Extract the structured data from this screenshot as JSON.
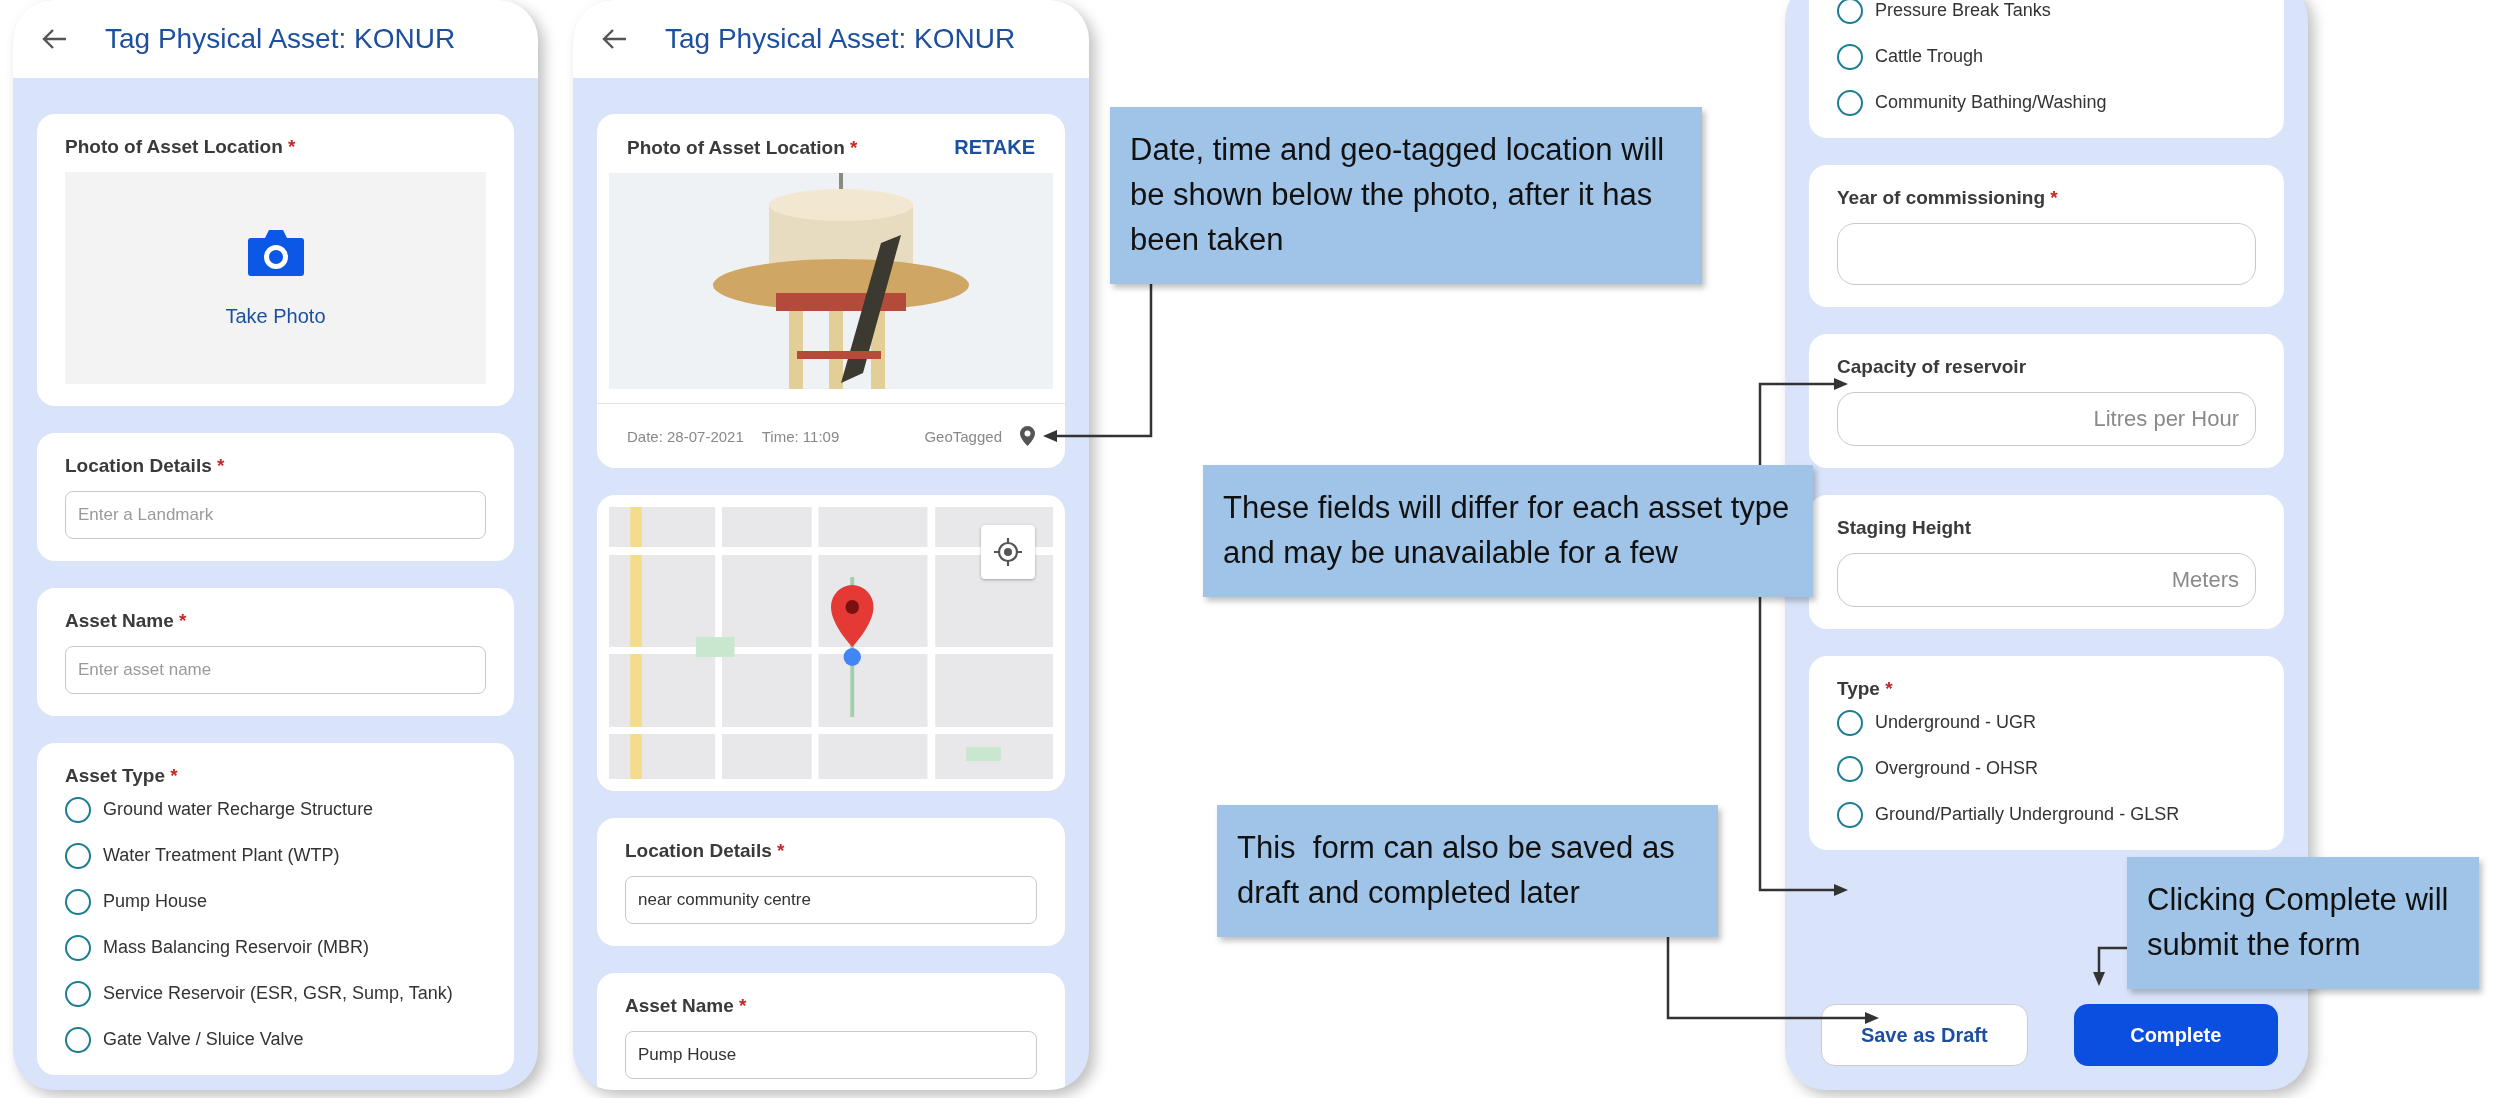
{
  "screens": [
    {
      "title": "Tag Physical Asset: KONUR",
      "sections": [
        {
          "label": "Photo of Asset Location",
          "mark": "*",
          "action": "Take Photo"
        },
        {
          "kind": "input",
          "label": "Location Details",
          "mark": "*",
          "placeholder": "Enter a Landmark"
        },
        {
          "kind": "input",
          "label": "Asset Name",
          "mark": "*",
          "placeholder": "Enter asset name"
        },
        {
          "kind": "radios",
          "label": "Asset Type",
          "mark": "*",
          "options": [
            {
              "label": "Ground water Recharge Structure",
              "selected": false
            },
            {
              "label": "Water Treatment Plant (WTP)",
              "selected": false
            },
            {
              "label": "Pump House",
              "selected": false
            },
            {
              "label": "Mass Balancing Reservoir (MBR)",
              "selected": false
            },
            {
              "label": "Service Reservoir (ESR, GSR, Sump, Tank)",
              "selected": false
            },
            {
              "label": "Gate Valve / Sluice Valve",
              "selected": false
            }
          ]
        }
      ]
    },
    {
      "title": "Tag Physical Asset: KONUR",
      "sections": [
        {
          "kind": "photo_taken",
          "label": "Photo of Asset Location",
          "mark": "*",
          "action": "RETAKE",
          "date": "Date: 28-07-2021",
          "time": "Time: 11:09",
          "geo": "GeoTagged"
        },
        {
          "kind": "map"
        },
        {
          "kind": "input",
          "label": "Location Details",
          "mark": "*",
          "value": "near community centre"
        },
        {
          "kind": "input",
          "label": "Asset Name",
          "mark": "*",
          "value": "Pump House"
        }
      ]
    },
    {
      "sections": [
        {
          "kind": "radios",
          "options": [
            {
              "label": "Pressure Break Tanks",
              "selected": false
            },
            {
              "label": "Cattle Trough",
              "selected": false
            },
            {
              "label": "Community Bathing/Washing",
              "selected": false
            }
          ]
        },
        {
          "kind": "input",
          "label": "Year of commissioning",
          "mark": "*"
        },
        {
          "kind": "unit_input",
          "label": "Capacity of reservoir",
          "placeholder": "Litres per Hour"
        },
        {
          "kind": "unit_input",
          "label": "Staging Height",
          "placeholder": "Meters"
        },
        {
          "kind": "radios",
          "label": "Type",
          "mark": "*",
          "options": [
            {
              "label": "Underground - UGR",
              "selected": false
            },
            {
              "label": "Overground - OHSR",
              "selected": false
            },
            {
              "label": "Ground/Partially Underground - GLSR",
              "selected": false
            }
          ]
        }
      ],
      "actions": [
        {
          "label": "Save as Draft",
          "primary": false
        },
        {
          "label": "Complete",
          "primary": true
        }
      ]
    }
  ],
  "callouts": [
    {
      "text": "Date, time and geo-tagged location will be shown below the photo, after it has been taken"
    },
    {
      "text": "These fields will differ for each asset type and may be unavailable for a few"
    },
    {
      "text": "This  form can also be saved as draft and completed later"
    },
    {
      "text": "Clicking Complete will submit the form"
    }
  ]
}
